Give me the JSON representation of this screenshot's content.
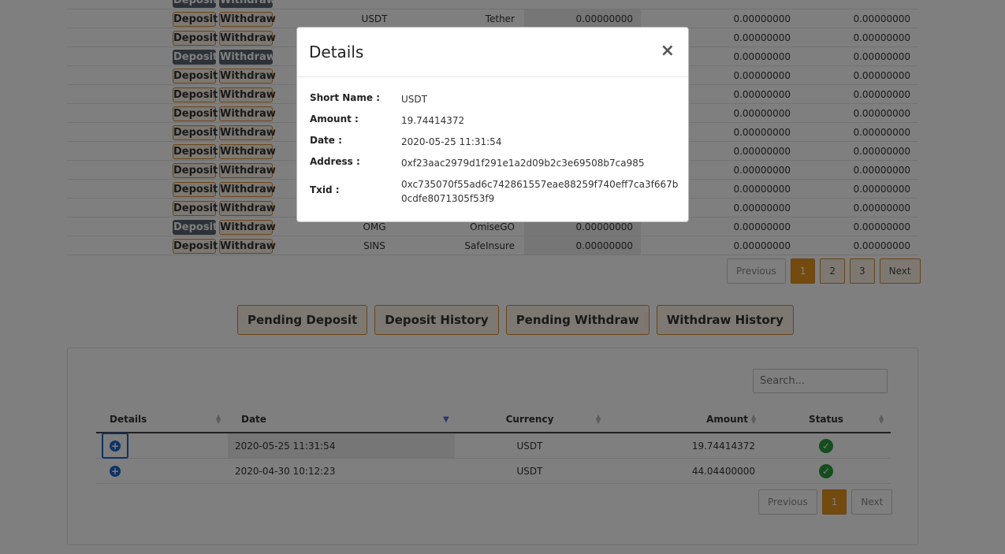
{
  "balances": {
    "deposit_label": "Deposit",
    "withdraw_label": "Withdraw",
    "rows": [
      {
        "short": "",
        "name": "",
        "b1": "",
        "b2": "",
        "b3": "",
        "active": true
      },
      {
        "short": "USDT",
        "name": "Tether",
        "b1": "0.00000000",
        "b2": "0.00000000",
        "b3": "0.00000000",
        "active": false
      },
      {
        "short": "",
        "name": "",
        "b1": "",
        "b2": "0.00000000",
        "b3": "0.00000000",
        "active": false
      },
      {
        "short": "",
        "name": "",
        "b1": "",
        "b2": "0.00000000",
        "b3": "0.00000000",
        "active": true
      },
      {
        "short": "",
        "name": "",
        "b1": "",
        "b2": "0.00000000",
        "b3": "0.00000000",
        "active": false
      },
      {
        "short": "",
        "name": "",
        "b1": "",
        "b2": "0.00000000",
        "b3": "0.00000000",
        "active": false
      },
      {
        "short": "",
        "name": "",
        "b1": "",
        "b2": "0.00000000",
        "b3": "0.00000000",
        "active": false
      },
      {
        "short": "",
        "name": "",
        "b1": "",
        "b2": "0.00000000",
        "b3": "0.00000000",
        "active": false
      },
      {
        "short": "",
        "name": "",
        "b1": "",
        "b2": "0.00000000",
        "b3": "0.00000000",
        "active": false
      },
      {
        "short": "",
        "name": "",
        "b1": "",
        "b2": "0.00000000",
        "b3": "0.00000000",
        "active": false
      },
      {
        "short": "",
        "name": "",
        "b1": "",
        "b2": "0.00000000",
        "b3": "0.00000000",
        "active": false
      },
      {
        "short": "",
        "name": "",
        "b1": "",
        "b2": "0.00000000",
        "b3": "0.00000000",
        "active": false
      },
      {
        "short": "OMG",
        "name": "OmiseGO",
        "b1": "0.00000000",
        "b2": "0.00000000",
        "b3": "0.00000000",
        "active": true
      },
      {
        "short": "SINS",
        "name": "SafeInsure",
        "b1": "0.00000000",
        "b2": "0.00000000",
        "b3": "0.00000000",
        "active": false
      }
    ]
  },
  "top_pager": {
    "previous": "Previous",
    "pages": [
      "1",
      "2",
      "3"
    ],
    "next": "Next"
  },
  "tabs": [
    "Pending Deposit",
    "Deposit History",
    "Pending Withdraw",
    "Withdraw History"
  ],
  "history": {
    "search_placeholder": "Search...",
    "headers": {
      "details": "Details",
      "date": "Date",
      "currency": "Currency",
      "amount": "Amount",
      "status": "Status"
    },
    "rows": [
      {
        "date": "2020-05-25 11:31:54",
        "currency": "USDT",
        "amount": "19.74414372"
      },
      {
        "date": "2020-04-30 10:12:23",
        "currency": "USDT",
        "amount": "44.04400000"
      }
    ],
    "pager": {
      "previous": "Previous",
      "page": "1",
      "next": "Next"
    }
  },
  "modal": {
    "title": "Details",
    "close": "×",
    "fields": [
      {
        "label": "Short Name :",
        "value": "USDT"
      },
      {
        "label": "Amount :",
        "value": "19.74414372"
      },
      {
        "label": "Date :",
        "value": "2020-05-25 11:31:54"
      },
      {
        "label": "Address :",
        "value": "0xf23aac2979d1f291e1a2d09b2c3e69508b7ca985"
      },
      {
        "label": "Txid :",
        "value": "0xc735070f55ad6c742861557eae88259f740eff7ca3f667b0cdfe8071305f53f9"
      }
    ]
  },
  "icons": {
    "plus": "plus-circle-icon",
    "check": "check-circle-icon",
    "close": "close-icon"
  },
  "colors": {
    "accent": "#e8961c",
    "accent_border": "#d48a2c",
    "link_blue": "#1a66c9",
    "success": "#2a9a3c"
  }
}
